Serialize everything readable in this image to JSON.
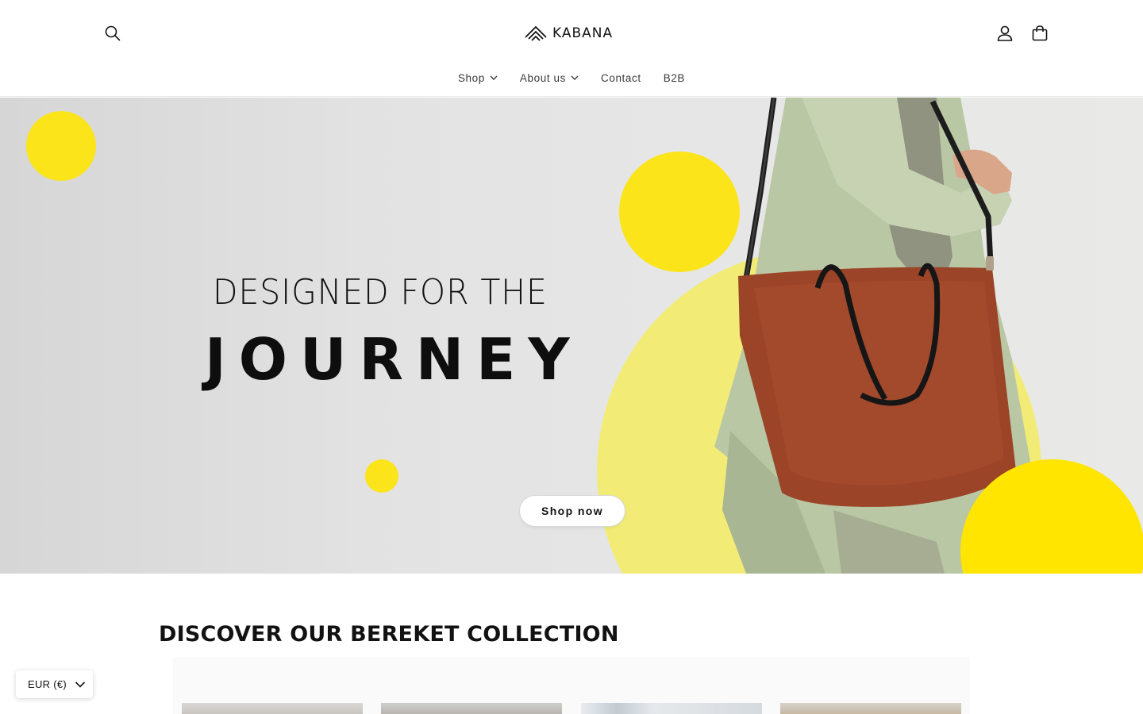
{
  "header": {
    "logo_text": "KABANA",
    "nav": [
      {
        "label": "Shop",
        "has_dropdown": true
      },
      {
        "label": "About us",
        "has_dropdown": true
      },
      {
        "label": "Contact",
        "has_dropdown": false
      },
      {
        "label": "B2B",
        "has_dropdown": false
      }
    ],
    "icons": [
      "search-icon",
      "account-icon",
      "cart-icon"
    ]
  },
  "hero": {
    "line1": "DESIGNED FOR THE",
    "line2": "JOURNEY",
    "button_label": "Shop now",
    "colors": {
      "accent_yellow": "#fbe41a",
      "pale_yellow": "#f2ec77",
      "bag_brown": "#9b4428",
      "coat_green": "#b9c7a4"
    }
  },
  "collection": {
    "title": "DISCOVER OUR BEREKET COLLECTION"
  },
  "currency": {
    "selected": "EUR (€)"
  }
}
